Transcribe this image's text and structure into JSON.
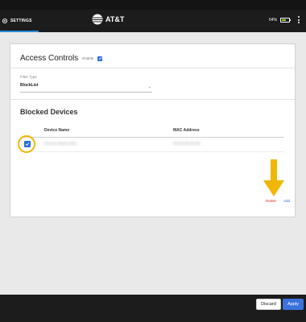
{
  "header": {
    "settings_label": "SETTINGS",
    "brand_name": "AT&T",
    "battery_percent": "64%",
    "battery_level": 0.64,
    "accent_color": "#2a8ad4"
  },
  "access_controls": {
    "title": "Access Controls",
    "enable_label": "Enable",
    "enable_checked": true,
    "filter": {
      "label": "Filter Type",
      "value": "BlockList"
    }
  },
  "blocked_devices": {
    "title": "Blocked Devices",
    "columns": [
      "Device Name",
      "MAC Address"
    ],
    "rows": [
      {
        "checked": true,
        "name": "Device-Name-Blur",
        "mac": "00:00:00:00:00"
      }
    ],
    "delete_label": "Delete",
    "add_label": "Add"
  },
  "footer": {
    "discard_label": "Discard",
    "apply_label": "Apply"
  },
  "colors": {
    "highlight": "#f2b705",
    "delete": "#d9302c",
    "primary": "#3a72dc"
  }
}
